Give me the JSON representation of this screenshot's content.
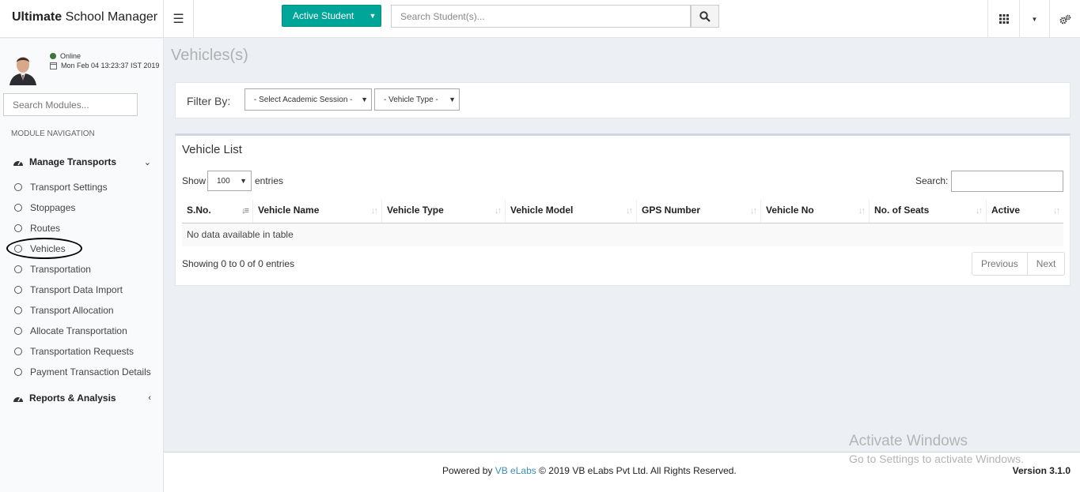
{
  "header": {
    "brand_bold": "Ultimate",
    "brand_rest": " School Manager",
    "active_student_label": "Active Student",
    "student_search_placeholder": "Search Student(s)..."
  },
  "sidebar": {
    "status": "Online",
    "datetime": "Mon Feb 04 13:23:37 IST 2019",
    "module_search_placeholder": "Search Modules...",
    "nav_header": "MODULE NAVIGATION",
    "section1": "Manage Transports",
    "items": [
      "Transport Settings",
      "Stoppages",
      "Routes",
      "Vehicles",
      "Transportation",
      "Transport Data Import",
      "Transport Allocation",
      "Allocate Transportation",
      "Transportation Requests",
      "Payment Transaction Details"
    ],
    "section2": "Reports & Analysis"
  },
  "page": {
    "title": "Vehicles(s)",
    "filter_label": "Filter By:",
    "session_select": "- Select Academic Session -",
    "vehicle_type_select": "- Vehicle Type -",
    "list_title": "Vehicle List",
    "show_label": "Show",
    "page_length": "100",
    "entries_label": "entries",
    "search_label": "Search:",
    "columns": [
      "S.No.",
      "Vehicle Name",
      "Vehicle Type",
      "Vehicle Model",
      "GPS Number",
      "Vehicle No",
      "No. of Seats",
      "Active"
    ],
    "empty_message": "No data available in table",
    "info": "Showing 0 to 0 of 0 entries",
    "prev_label": "Previous",
    "next_label": "Next"
  },
  "footer": {
    "powered_by": "Powered by",
    "company_link": "VB eLabs",
    "copyright": "© 2019 VB eLabs Pvt Ltd. All Rights Reserved.",
    "version": "Version 3.1.0"
  },
  "watermark": {
    "line1": "Activate Windows",
    "line2": "Go to Settings to activate Windows."
  }
}
